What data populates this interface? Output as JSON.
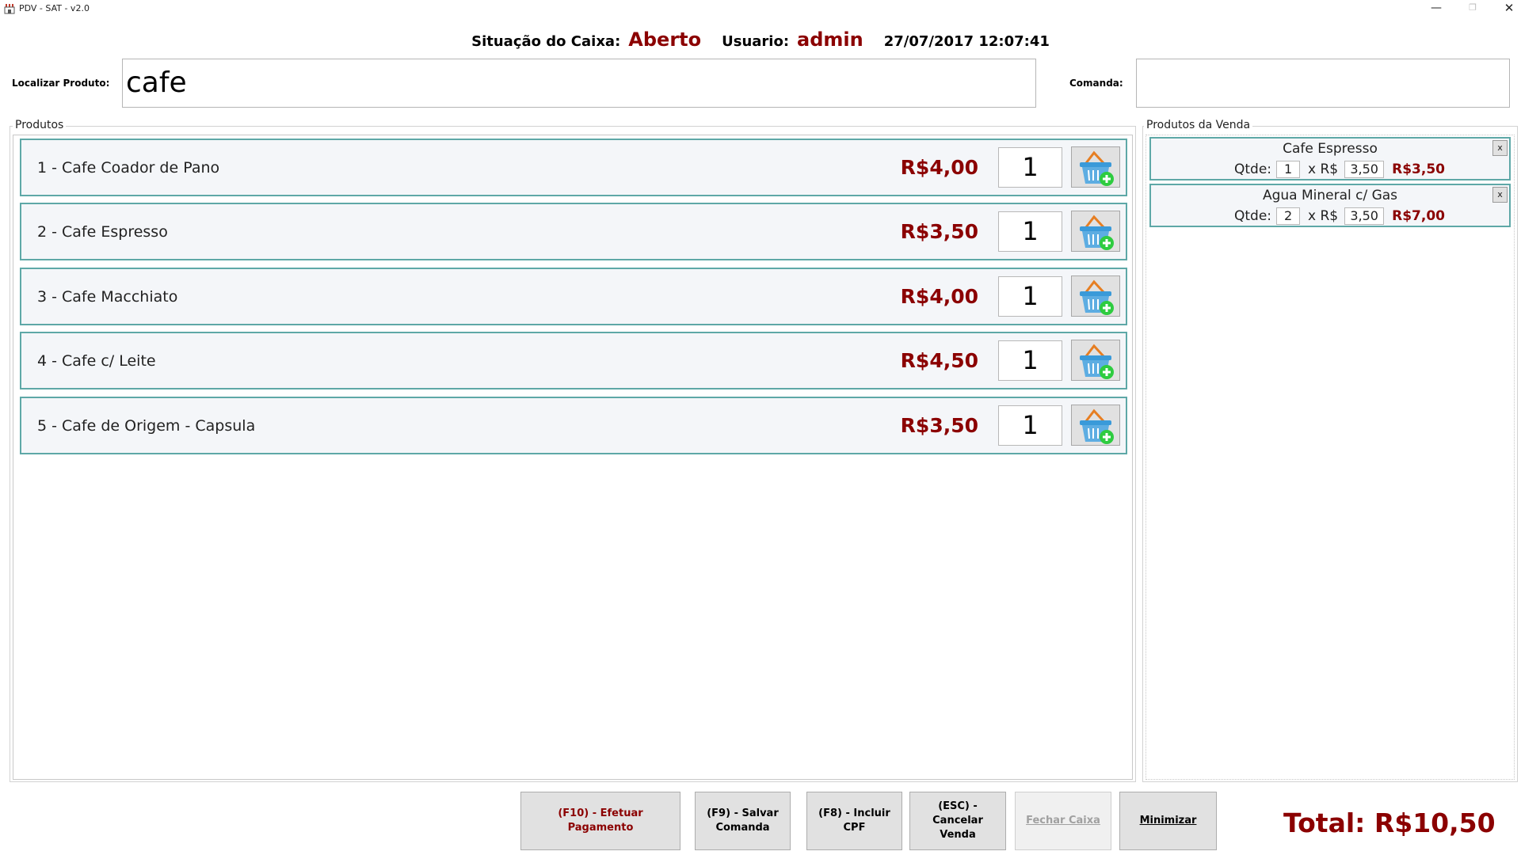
{
  "window": {
    "title": "PDV - SAT - v2.0",
    "minimize": "—",
    "maximize": "❐",
    "close": "✕"
  },
  "header": {
    "status_label": "Situação do Caixa:",
    "status_value": "Aberto",
    "user_label": "Usuario:",
    "user_value": "admin",
    "datetime": "27/07/2017 12:07:41"
  },
  "search": {
    "label": "Localizar Produto:",
    "value": "cafe"
  },
  "comanda": {
    "label": "Comanda:",
    "value": ""
  },
  "products_group": {
    "title": "Produtos"
  },
  "products": [
    {
      "label": "1 - Cafe Coador de Pano",
      "price": "R$4,00",
      "qty": "1"
    },
    {
      "label": "2 - Cafe Espresso",
      "price": "R$3,50",
      "qty": "1"
    },
    {
      "label": "3 - Cafe Macchiato",
      "price": "R$4,00",
      "qty": "1"
    },
    {
      "label": "4 - Cafe c/ Leite",
      "price": "R$4,50",
      "qty": "1"
    },
    {
      "label": "5 - Cafe de Origem - Capsula",
      "price": "R$3,50",
      "qty": "1"
    }
  ],
  "sale_group": {
    "title": "Produtos da Venda"
  },
  "sale_items": [
    {
      "name": "Cafe Espresso",
      "qty_label": "Qtde:",
      "qty": "1",
      "times": "x R$",
      "unit": "3,50",
      "total": "R$3,50",
      "remove": "x"
    },
    {
      "name": "Agua Mineral c/ Gas",
      "qty_label": "Qtde:",
      "qty": "2",
      "times": "x R$",
      "unit": "3,50",
      "total": "R$7,00",
      "remove": "x"
    }
  ],
  "buttons": {
    "pay": "(F10) - Efetuar Pagamento",
    "save": "(F9) - Salvar Comanda",
    "cpf": "(F8) - Incluir CPF",
    "cancel": "(ESC) - Cancelar Venda",
    "close_register": "Fechar Caixa",
    "minimize": "Minimizar"
  },
  "total": "Total: R$10,50",
  "colors": {
    "accent_red": "#8b0000",
    "row_border": "#5ea8a7",
    "row_bg": "#f4f6f9"
  },
  "icons": {
    "add_to_basket": "basket-add-icon",
    "app": "store-icon"
  }
}
